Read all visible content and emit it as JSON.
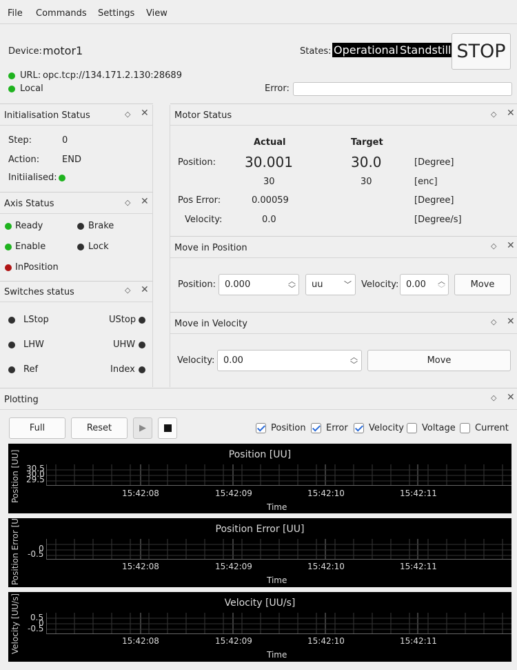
{
  "menu": {
    "file": "File",
    "commands": "Commands",
    "settings": "Settings",
    "view": "View"
  },
  "device": {
    "label": "Device:",
    "name": "motor1",
    "states_label": "States:",
    "state1": "Operational",
    "state2": "Standstill",
    "stop": "STOP",
    "url_label": "URL:",
    "url": "opc.tcp://134.171.2.130:28689",
    "local": "Local",
    "error_label": "Error:",
    "error_value": ""
  },
  "init": {
    "title": "Initialisation Status",
    "step_label": "Step:",
    "step": "0",
    "action_label": "Action:",
    "action": "END",
    "initialised_label": "Initiialised:"
  },
  "axis": {
    "title": "Axis Status",
    "ready": "Ready",
    "brake": "Brake",
    "enable": "Enable",
    "lock": "Lock",
    "inposition": "InPosition"
  },
  "switches": {
    "title": "Switches status",
    "lstop": "LStop",
    "ustop": "UStop",
    "lhw": "LHW",
    "uhw": "UHW",
    "ref": "Ref",
    "index": "Index"
  },
  "motor": {
    "title": "Motor Status",
    "actual": "Actual",
    "target": "Target",
    "position_label": "Position:",
    "pos_actual": "30.001",
    "pos_target": "30.0",
    "pos_unit": "[Degree]",
    "enc_actual": "30",
    "enc_target": "30",
    "enc_unit": "[enc]",
    "poserr_label": "Pos Error:",
    "poserr": "0.00059",
    "poserr_unit": "[Degree]",
    "vel_label": "Velocity:",
    "vel": "0.0",
    "vel_unit": "[Degree/s]"
  },
  "move_pos": {
    "title": "Move in Position",
    "position_label": "Position:",
    "position": "0.000",
    "unit": "uu",
    "velocity_label": "Velocity:",
    "velocity": "0.00",
    "move": "Move"
  },
  "move_vel": {
    "title": "Move in Velocity",
    "velocity_label": "Velocity:",
    "velocity": "0.00",
    "move": "Move"
  },
  "plotting": {
    "title": "Plotting",
    "full": "Full",
    "reset": "Reset",
    "cb_position": "Position",
    "cb_error": "Error",
    "cb_velocity": "Velocity",
    "cb_voltage": "Voltage",
    "cb_current": "Current"
  },
  "chart_data": [
    {
      "type": "line",
      "title": "Position [UU]",
      "ylabel": "Position [UU]",
      "xlabel": "Time",
      "yticks": [
        "30.5",
        "30.0",
        "29.5"
      ],
      "xticks": [
        "15:42:08",
        "15:42:09",
        "15:42:10",
        "15:42:11"
      ],
      "series": []
    },
    {
      "type": "line",
      "title": "Position Error [UU]",
      "ylabel": "Position Error [UU]",
      "xlabel": "Time",
      "yticks": [
        "0",
        "-0.5"
      ],
      "xticks": [
        "15:42:08",
        "15:42:09",
        "15:42:10",
        "15:42:11"
      ],
      "series": []
    },
    {
      "type": "line",
      "title": "Velocity [UU/s]",
      "ylabel": "Velocity [UU/s]",
      "xlabel": "Time",
      "yticks": [
        "0.5",
        "0",
        "-0.5"
      ],
      "xticks": [
        "15:42:08",
        "15:42:09",
        "15:42:10",
        "15:42:11"
      ],
      "series": []
    }
  ]
}
